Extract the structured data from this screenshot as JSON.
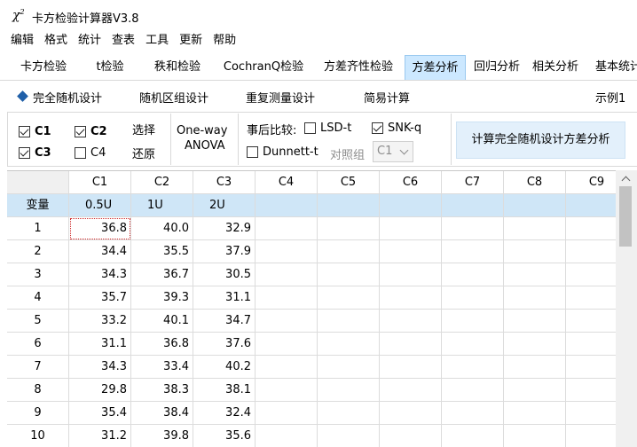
{
  "window": {
    "icon_glyph": "χ",
    "icon_sup": "2",
    "title": "卡方检验计算器V3.8"
  },
  "menu": [
    "编辑",
    "格式",
    "统计",
    "查表",
    "工具",
    "更新",
    "帮助"
  ],
  "tabs": [
    {
      "label": "卡方检验",
      "active": false
    },
    {
      "label": "t检验",
      "active": false
    },
    {
      "label": "秩和检验",
      "active": false
    },
    {
      "label": "CochranQ检验",
      "active": false
    },
    {
      "label": "方差齐性检验",
      "active": false
    },
    {
      "label": "方差分析",
      "active": true
    },
    {
      "label": "回归分析",
      "active": false
    },
    {
      "label": "相关分析",
      "active": false
    },
    {
      "label": "基本统计",
      "active": false
    }
  ],
  "subtabs": {
    "completely_random": "完全随机设计",
    "random_block": "随机区组设计",
    "repeated_measures": "重复测量设计",
    "simple_calc": "简易计算",
    "example": "示例1"
  },
  "columns_select": {
    "c1": {
      "label": "C1",
      "checked": true
    },
    "c2": {
      "label": "C2",
      "checked": true
    },
    "c3": {
      "label": "C3",
      "checked": true
    },
    "c4": {
      "label": "C4",
      "checked": false
    },
    "select": "选择",
    "restore": "还原"
  },
  "anova_label": {
    "line1": "One-way",
    "line2": "ANOVA"
  },
  "posthoc": {
    "label": "事后比较:",
    "lsd": {
      "label": "LSD-t",
      "checked": false
    },
    "snk": {
      "label": "SNK-q",
      "checked": true
    },
    "dunnett": {
      "label": "Dunnett-t",
      "checked": false
    },
    "control_label": "对照组",
    "control_value": "C1"
  },
  "calc_button": "计算完全随机设计方差分析",
  "grid": {
    "columns": [
      "C1",
      "C2",
      "C3",
      "C4",
      "C5",
      "C6",
      "C7",
      "C8",
      "C9"
    ],
    "var_row_label": "变量",
    "var_names": [
      "0.5U",
      "1U",
      "2U",
      "",
      "",
      "",
      "",
      "",
      ""
    ],
    "rows": [
      {
        "n": "1",
        "vals": [
          "36.8",
          "40.0",
          "32.9"
        ]
      },
      {
        "n": "2",
        "vals": [
          "34.4",
          "35.5",
          "37.9"
        ]
      },
      {
        "n": "3",
        "vals": [
          "34.3",
          "36.7",
          "30.5"
        ]
      },
      {
        "n": "4",
        "vals": [
          "35.7",
          "39.3",
          "31.1"
        ]
      },
      {
        "n": "5",
        "vals": [
          "33.2",
          "40.1",
          "34.7"
        ]
      },
      {
        "n": "6",
        "vals": [
          "31.1",
          "36.8",
          "37.6"
        ]
      },
      {
        "n": "7",
        "vals": [
          "34.3",
          "33.4",
          "40.2"
        ]
      },
      {
        "n": "8",
        "vals": [
          "29.8",
          "38.3",
          "38.1"
        ]
      },
      {
        "n": "9",
        "vals": [
          "35.4",
          "38.4",
          "32.4"
        ]
      },
      {
        "n": "10",
        "vals": [
          "31.2",
          "39.8",
          "35.6"
        ]
      }
    ]
  }
}
